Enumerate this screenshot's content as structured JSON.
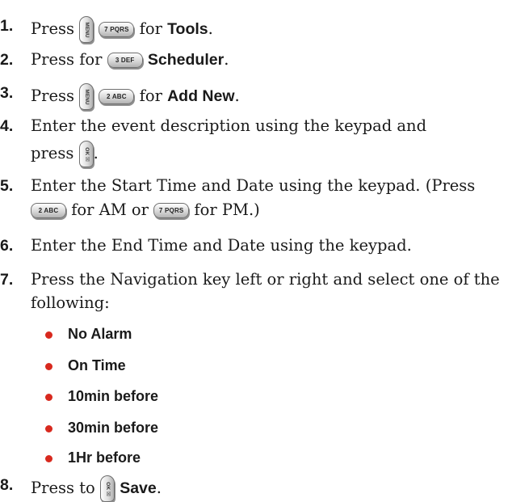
{
  "steps": [
    {
      "number": "1.",
      "prefix": "Press",
      "keys": [
        "menu-icon",
        "7-pqrs-key"
      ],
      "middle": "for",
      "bold": "Tools",
      "end": "."
    },
    {
      "number": "2.",
      "prefix": "Press for",
      "keys": [
        "3-def-key"
      ],
      "bold": "Scheduler",
      "end": "."
    },
    {
      "number": "3.",
      "prefix": "Press",
      "keys": [
        "menu-icon",
        "2-abc-key"
      ],
      "middle": "for",
      "bold": "Add New",
      "end": "."
    },
    {
      "number": "4.",
      "line1": "Enter the event description using the keypad and",
      "prefix": "press",
      "keys": [
        "ok-icon"
      ],
      "end": "."
    },
    {
      "number": "5.",
      "line1": "Enter the Start Time and Date using the keypad. (Press",
      "keys": [
        "2-abc-key",
        "7-pqrs-key"
      ],
      "for_am": "for AM or",
      "for_pm": "for PM.)"
    },
    {
      "number": "6.",
      "line1": "Enter the End Time and Date using the keypad."
    },
    {
      "number": "7.",
      "line1": "Press the Navigation key left or right and select one of the",
      "line2": "following:"
    },
    {
      "number": "8.",
      "prefix": "Press to",
      "keys": [
        "ok-icon"
      ],
      "bold": "Save",
      "end": "."
    }
  ],
  "options": [
    "No Alarm",
    "On Time",
    "10min before",
    "30min before",
    "1Hr before"
  ],
  "keys": {
    "menu": "MENU",
    "ok": "OK ☒",
    "seven": "7 PQRS",
    "three": "3 DEF",
    "two": "2 ABC"
  },
  "colors": {
    "bullet": "#d8291e",
    "text": "#1a1a1a",
    "key_border": "#6f6f6f"
  }
}
